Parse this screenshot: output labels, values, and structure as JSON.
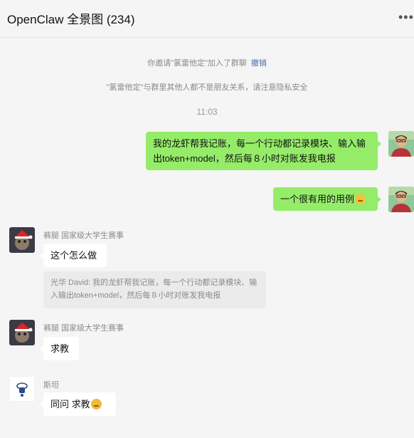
{
  "header": {
    "title": "OpenClaw 全景图 (234)",
    "more": "•••"
  },
  "system": {
    "invite_text": "你邀请\"氯雷他定\"加入了群聊",
    "undo_label": "撤销",
    "privacy_notice": "\"氯雷他定\"与群里其他人都不是朋友关系，请注意隐私安全",
    "time": "11:03"
  },
  "messages": [
    {
      "sender": "self",
      "text": "我的龙虾帮我记账，每一个行动都记录模块、输入输出token+model，然后每８小时对账发我电报"
    },
    {
      "sender": "self",
      "text": "一个很有用的用例",
      "emoji": "thinking-face"
    },
    {
      "sender": "裤腿 国家级大学生赛事",
      "text": "这个怎么做",
      "quote": "光华 David: 我的龙虾帮我记账，每一个行动都记录模块、输入输出token+model，然后每８小时对账发我电报"
    },
    {
      "sender": "裤腿 国家级大学生赛事",
      "text": "求教"
    },
    {
      "sender": "斯坦",
      "text": "同问  求教",
      "emoji": "folded-hands"
    }
  ],
  "colors": {
    "self_bubble": "#95ec69",
    "other_bubble": "#ffffff",
    "background": "#f5f5f5",
    "link": "#4a6ea8"
  }
}
